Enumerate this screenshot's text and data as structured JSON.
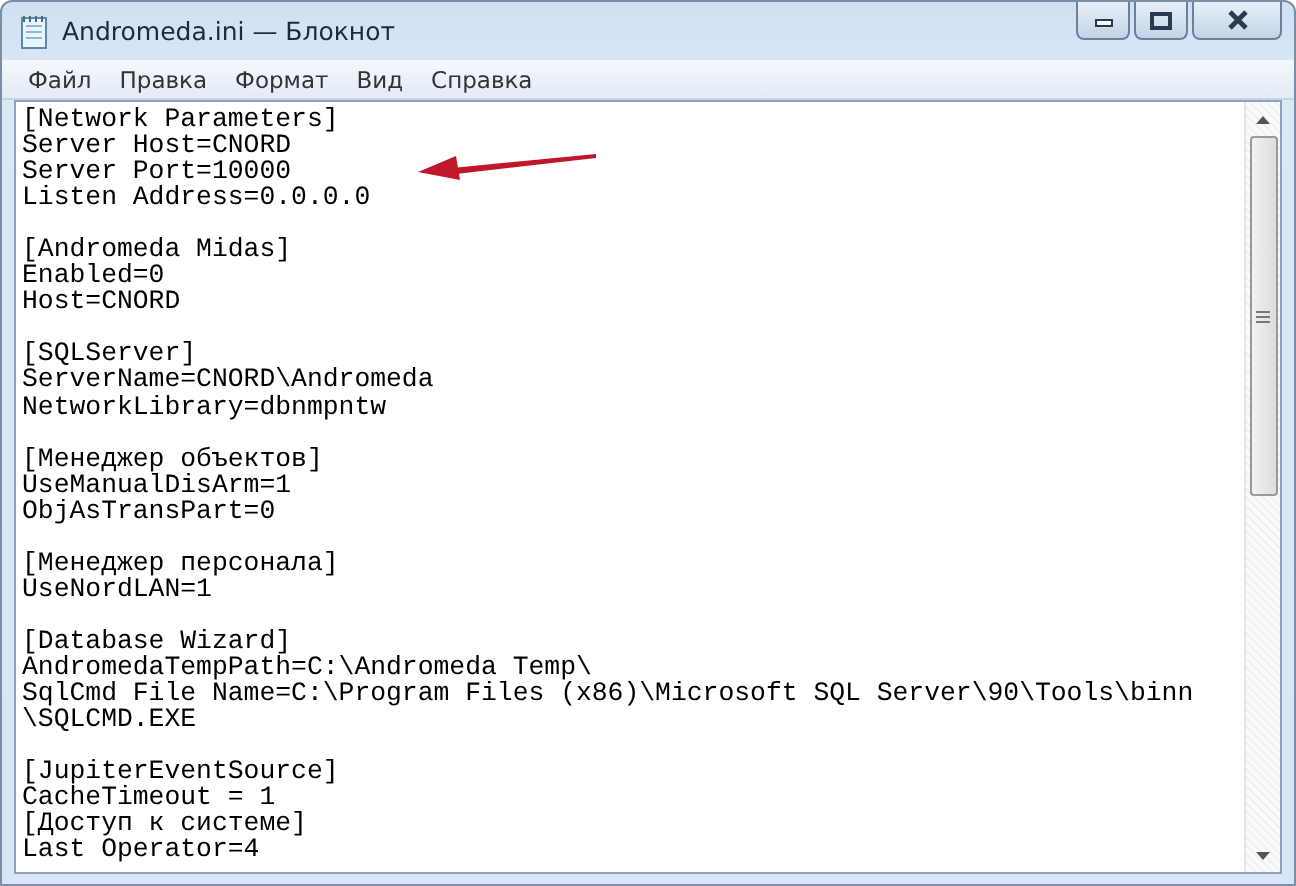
{
  "window": {
    "title": "Andromeda.ini — Блокнот"
  },
  "menu": [
    "Файл",
    "Правка",
    "Формат",
    "Вид",
    "Справка"
  ],
  "blocks": [
    [
      "[Network Parameters]",
      "Server Host=CNORD",
      "Server Port=10000",
      "Listen Address=0.0.0.0"
    ],
    [
      "[Andromeda Midas]",
      "Enabled=0",
      "Host=CNORD"
    ],
    [
      "[SQLServer]",
      "ServerName=CNORD\\Andromeda",
      "NetworkLibrary=dbnmpntw"
    ],
    [
      "[Менеджер объектов]",
      "UseManualDisArm=1",
      "ObjAsTransPart=0"
    ],
    [
      "[Менеджер персонала]",
      "UseNordLAN=1"
    ],
    [
      "[Database Wizard]",
      "AndromedaTempPath=C:\\Andromeda Temp\\",
      "SqlCmd File Name=C:\\Program Files (x86)\\Microsoft SQL Server\\90\\Tools\\binn",
      "\\SQLCMD.EXE"
    ],
    [
      "[JupiterEventSource]",
      "CacheTimeout = 1",
      "[Доступ к системе]",
      "Last Operator=4"
    ]
  ]
}
